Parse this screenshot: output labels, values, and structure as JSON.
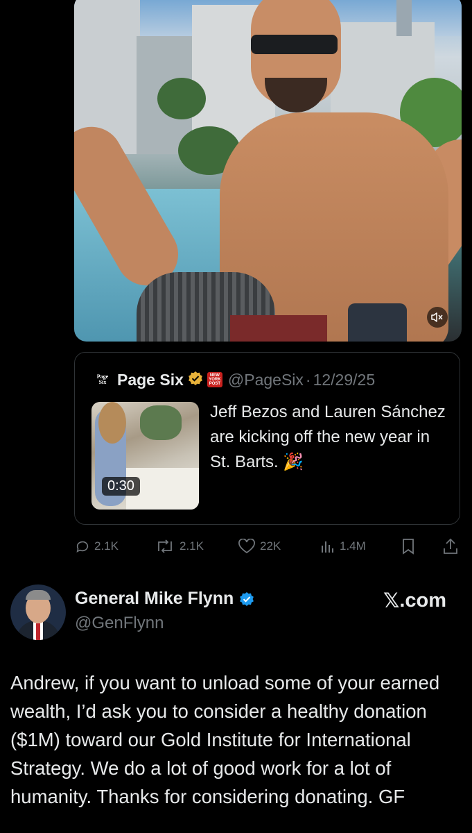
{
  "video": {
    "mute_icon": "speaker-muted-icon"
  },
  "quoted": {
    "logo_text": "Page Six",
    "name": "Page Six",
    "nyp_text": "NEW YORK POST",
    "handle": "@PageSix",
    "separator": "·",
    "date": "12/29/25",
    "text": "Jeff Bezos and Lauren Sánchez are kicking off the new year in St. Barts. 🎉",
    "duration": "0:30",
    "badge_color": "#e8b23a"
  },
  "actions": {
    "replies": "2.1K",
    "reposts": "2.1K",
    "likes": "22K",
    "views": "1.4M"
  },
  "reply": {
    "name": "General Mike Flynn",
    "handle": "@GenFlynn",
    "watermark_glyph": "𝕏",
    "watermark_text": ".com",
    "text": "Andrew, if you want to unload some of your earned wealth, I’d ask you to consider a healthy donation ($1M) toward our Gold Institute for International Strategy. We do a lot of good work for a lot of humanity. Thanks for considering donating. GF",
    "verified_color": "#1d9bf0"
  }
}
